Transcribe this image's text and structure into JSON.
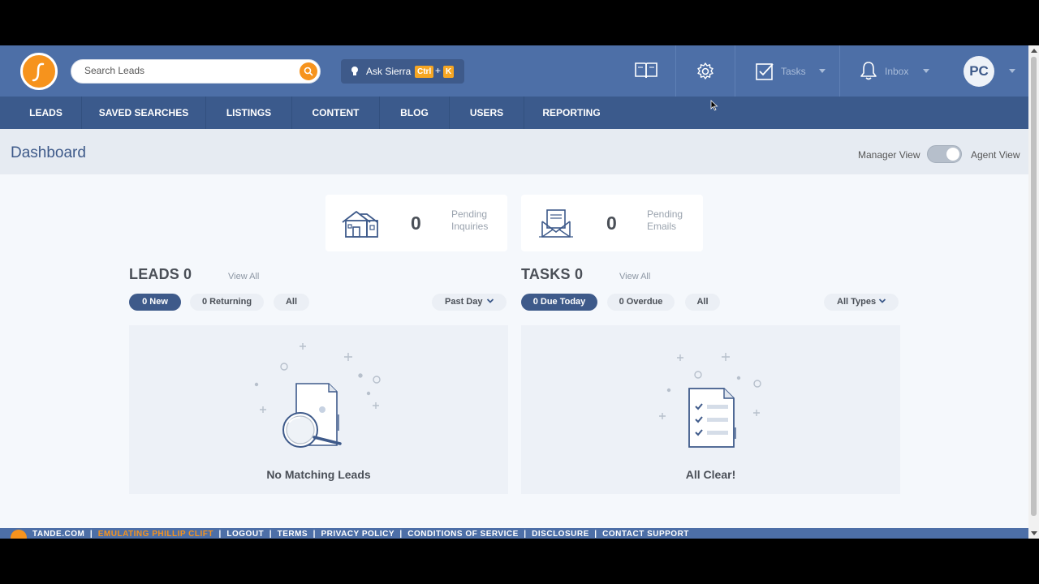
{
  "search": {
    "placeholder": "Search Leads"
  },
  "ask": {
    "label": "Ask Sierra",
    "key1": "Ctrl",
    "plus": "+",
    "key2": "K"
  },
  "topbar": {
    "tasks_label": "Tasks",
    "inbox_label": "Inbox",
    "avatar_initials": "PC"
  },
  "nav": {
    "items": [
      "LEADS",
      "SAVED SEARCHES",
      "LISTINGS",
      "CONTENT",
      "BLOG",
      "USERS",
      "REPORTING"
    ]
  },
  "page": {
    "title": "Dashboard",
    "manager_view": "Manager View",
    "agent_view": "Agent View"
  },
  "stats": [
    {
      "value": "0",
      "label": "Pending Inquiries"
    },
    {
      "value": "0",
      "label": "Pending Emails"
    }
  ],
  "leads": {
    "title": "LEADS",
    "count": "0",
    "view_all": "View All",
    "filters": [
      "0 New",
      "0 Returning",
      "All"
    ],
    "period": "Past Day",
    "empty_message": "No Matching Leads"
  },
  "tasks": {
    "title": "TASKS",
    "count": "0",
    "view_all": "View All",
    "filters": [
      "0 Due Today",
      "0 Overdue",
      "All"
    ],
    "type": "All Types",
    "empty_message": "All Clear!"
  },
  "footer": {
    "site": "TANDE.COM",
    "emulating": "EMULATING PHILLIP CLIFT",
    "links": [
      "LOGOUT",
      "TERMS",
      "PRIVACY POLICY",
      "CONDITIONS OF SERVICE",
      "DISCLOSURE",
      "CONTACT SUPPORT"
    ]
  },
  "colors": {
    "brand_blue": "#4d6fa7",
    "nav_blue": "#3b5a8c",
    "accent_orange": "#f6931d"
  }
}
